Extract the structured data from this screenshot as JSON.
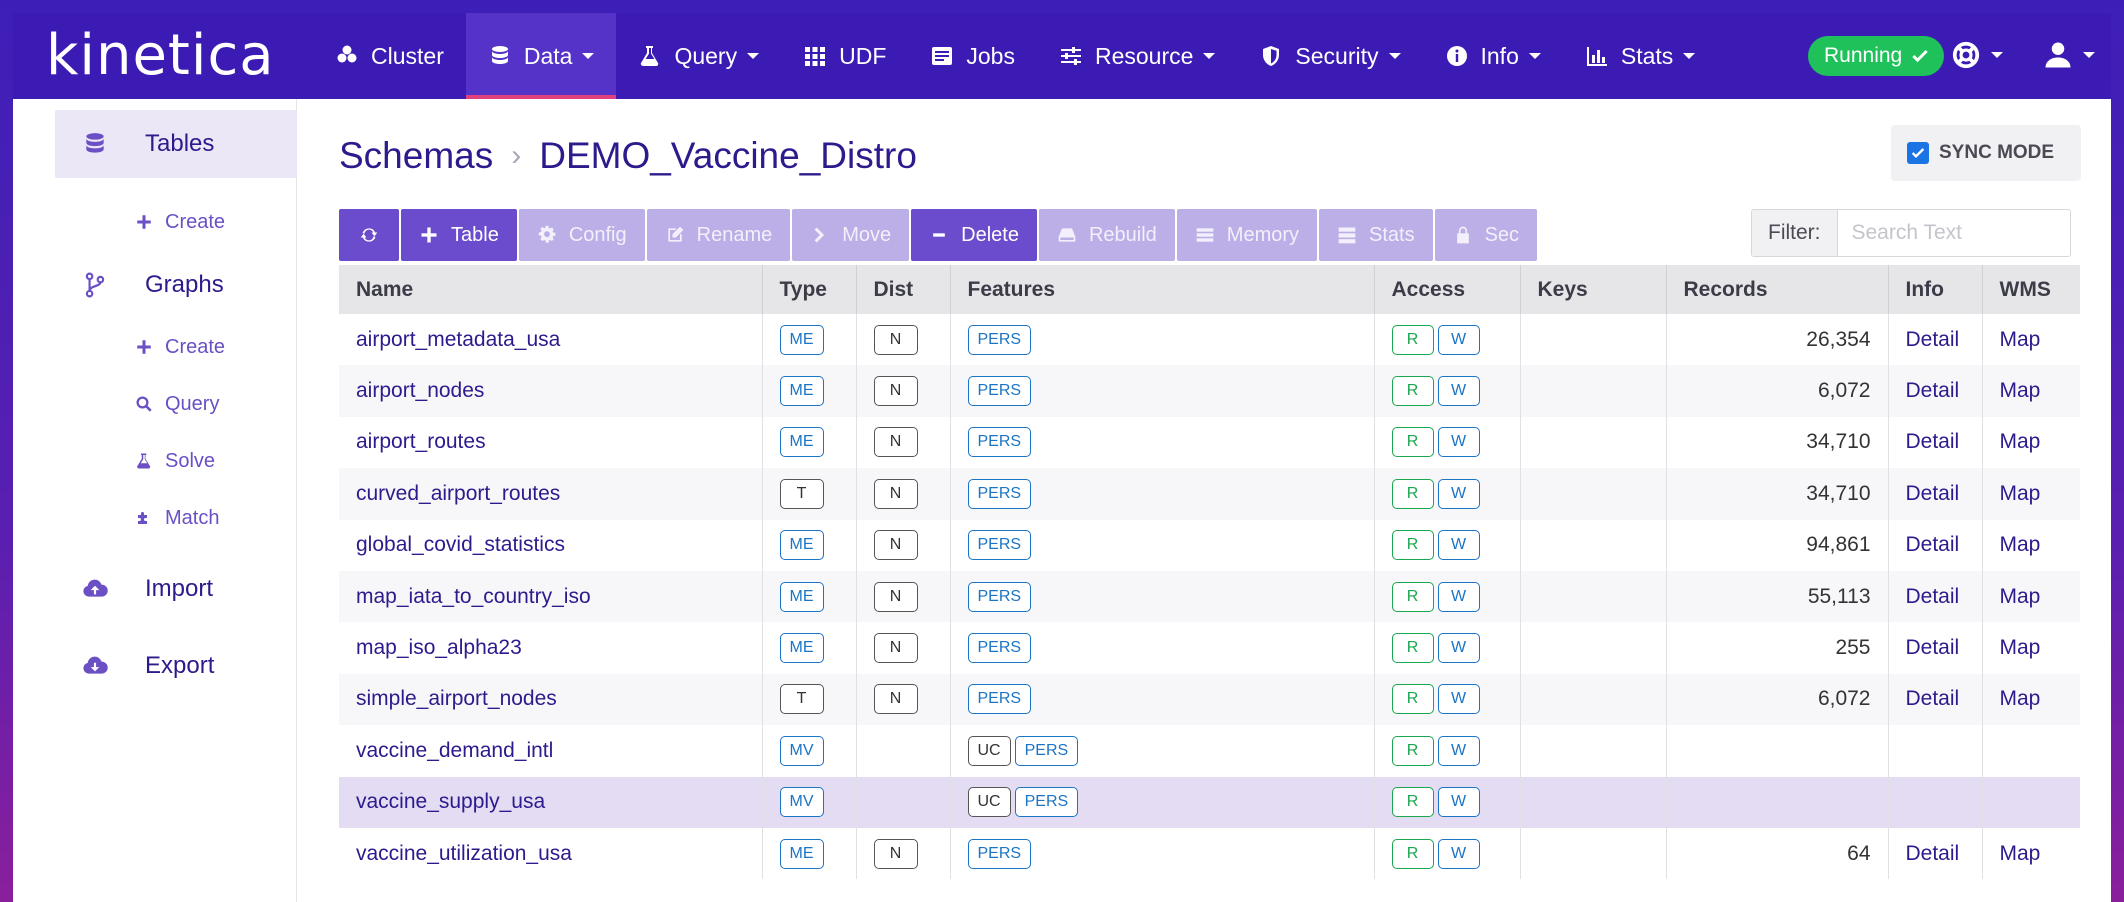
{
  "brand": {
    "logo_text": "kinetica"
  },
  "nav": {
    "items": [
      {
        "label": "Cluster",
        "icon": "cluster-icon",
        "has_caret": false,
        "active": false
      },
      {
        "label": "Data",
        "icon": "database-icon",
        "has_caret": true,
        "active": true
      },
      {
        "label": "Query",
        "icon": "flask-icon",
        "has_caret": true,
        "active": false
      },
      {
        "label": "UDF",
        "icon": "grid-icon",
        "has_caret": false,
        "active": false
      },
      {
        "label": "Jobs",
        "icon": "jobs-icon",
        "has_caret": false,
        "active": false
      },
      {
        "label": "Resource",
        "icon": "sliders-icon",
        "has_caret": true,
        "active": false
      },
      {
        "label": "Security",
        "icon": "shield-icon",
        "has_caret": true,
        "active": false
      },
      {
        "label": "Info",
        "icon": "info-icon",
        "has_caret": true,
        "active": false
      },
      {
        "label": "Stats",
        "icon": "bar-chart-icon",
        "has_caret": true,
        "active": false
      }
    ],
    "status_label": "Running",
    "status_color": "#1fc25a",
    "help_icon": "lifebuoy-icon",
    "user_icon": "user-icon"
  },
  "sidebar": {
    "tables_label": "Tables",
    "tables_create": "Create",
    "graphs_label": "Graphs",
    "graphs_create": "Create",
    "graphs_query": "Query",
    "graphs_solve": "Solve",
    "graphs_match": "Match",
    "import_label": "Import",
    "export_label": "Export"
  },
  "breadcrumb": {
    "root": "Schemas",
    "current": "DEMO_Vaccine_Distro"
  },
  "sync_mode": {
    "label": "SYNC MODE",
    "checked": true
  },
  "toolbar": {
    "refresh_icon": "refresh-icon",
    "table": "Table",
    "config": "Config",
    "rename": "Rename",
    "move": "Move",
    "delete": "Delete",
    "rebuild": "Rebuild",
    "memory": "Memory",
    "stats": "Stats",
    "sec": "Sec"
  },
  "filter": {
    "label": "Filter:",
    "placeholder": "Search Text",
    "value": ""
  },
  "table": {
    "columns": [
      "Name",
      "Type",
      "Dist",
      "Features",
      "Access",
      "Keys",
      "Records",
      "Info",
      "WMS"
    ],
    "rows": [
      {
        "name": "airport_metadata_usa",
        "type": "ME",
        "dist": "N",
        "features": [
          "PERS"
        ],
        "access_r": "R",
        "access_w": "W",
        "keys": "",
        "records": "26,354",
        "info": "Detail",
        "wms": "Map",
        "selected": false
      },
      {
        "name": "airport_nodes",
        "type": "ME",
        "dist": "N",
        "features": [
          "PERS"
        ],
        "access_r": "R",
        "access_w": "W",
        "keys": "",
        "records": "6,072",
        "info": "Detail",
        "wms": "Map",
        "selected": false
      },
      {
        "name": "airport_routes",
        "type": "ME",
        "dist": "N",
        "features": [
          "PERS"
        ],
        "access_r": "R",
        "access_w": "W",
        "keys": "",
        "records": "34,710",
        "info": "Detail",
        "wms": "Map",
        "selected": false
      },
      {
        "name": "curved_airport_routes",
        "type": "T",
        "dist": "N",
        "features": [
          "PERS"
        ],
        "access_r": "R",
        "access_w": "W",
        "keys": "",
        "records": "34,710",
        "info": "Detail",
        "wms": "Map",
        "selected": false
      },
      {
        "name": "global_covid_statistics",
        "type": "ME",
        "dist": "N",
        "features": [
          "PERS"
        ],
        "access_r": "R",
        "access_w": "W",
        "keys": "",
        "records": "94,861",
        "info": "Detail",
        "wms": "Map",
        "selected": false
      },
      {
        "name": "map_iata_to_country_iso",
        "type": "ME",
        "dist": "N",
        "features": [
          "PERS"
        ],
        "access_r": "R",
        "access_w": "W",
        "keys": "",
        "records": "55,113",
        "info": "Detail",
        "wms": "Map",
        "selected": false
      },
      {
        "name": "map_iso_alpha23",
        "type": "ME",
        "dist": "N",
        "features": [
          "PERS"
        ],
        "access_r": "R",
        "access_w": "W",
        "keys": "",
        "records": "255",
        "info": "Detail",
        "wms": "Map",
        "selected": false
      },
      {
        "name": "simple_airport_nodes",
        "type": "T",
        "dist": "N",
        "features": [
          "PERS"
        ],
        "access_r": "R",
        "access_w": "W",
        "keys": "",
        "records": "6,072",
        "info": "Detail",
        "wms": "Map",
        "selected": false
      },
      {
        "name": "vaccine_demand_intl",
        "type": "MV",
        "dist": "",
        "features": [
          "UC",
          "PERS"
        ],
        "access_r": "R",
        "access_w": "W",
        "keys": "",
        "records": "",
        "info": "",
        "wms": "",
        "selected": false
      },
      {
        "name": "vaccine_supply_usa",
        "type": "MV",
        "dist": "",
        "features": [
          "UC",
          "PERS"
        ],
        "access_r": "R",
        "access_w": "W",
        "keys": "",
        "records": "",
        "info": "",
        "wms": "",
        "selected": true
      },
      {
        "name": "vaccine_utilization_usa",
        "type": "ME",
        "dist": "N",
        "features": [
          "PERS"
        ],
        "access_r": "R",
        "access_w": "W",
        "keys": "",
        "records": "64",
        "info": "Detail",
        "wms": "Map",
        "selected": false
      }
    ]
  },
  "colors": {
    "nav_bg": "#3b1bb4",
    "accent": "#6a4ccc",
    "active_underline": "#e0407e",
    "link": "#2d1a8c"
  }
}
